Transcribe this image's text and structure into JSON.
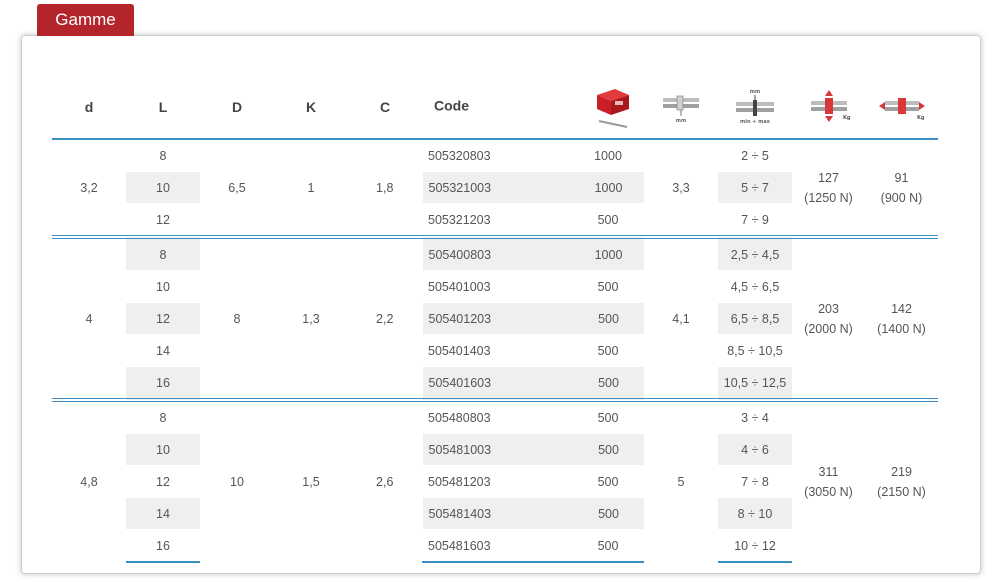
{
  "tab": {
    "label": "Gamme"
  },
  "columns": [
    "d",
    "L",
    "D",
    "K",
    "C",
    "Code"
  ],
  "icons": [
    "box-icon",
    "thickness-icon",
    "grip-range-icon",
    "shear-force-icon",
    "tensile-force-icon"
  ],
  "groups": [
    {
      "d": "3,2",
      "D": "6,5",
      "K": "1",
      "C": "1,8",
      "thickness": "3,3",
      "shear_kg": "127",
      "shear_n": "(1250 N)",
      "tensile_kg": "91",
      "tensile_n": "(900 N)",
      "rows": [
        {
          "L": "8",
          "code": "505320803",
          "box": "1000",
          "grip": "2 ÷ 5"
        },
        {
          "L": "10",
          "code": "505321003",
          "box": "1000",
          "grip": "5 ÷ 7"
        },
        {
          "L": "12",
          "code": "505321203",
          "box": "500",
          "grip": "7 ÷ 9"
        }
      ]
    },
    {
      "d": "4",
      "D": "8",
      "K": "1,3",
      "C": "2,2",
      "thickness": "4,1",
      "shear_kg": "203",
      "shear_n": "(2000 N)",
      "tensile_kg": "142",
      "tensile_n": "(1400 N)",
      "rows": [
        {
          "L": "8",
          "code": "505400803",
          "box": "1000",
          "grip": "2,5 ÷ 4,5"
        },
        {
          "L": "10",
          "code": "505401003",
          "box": "500",
          "grip": "4,5 ÷ 6,5"
        },
        {
          "L": "12",
          "code": "505401203",
          "box": "500",
          "grip": "6,5 ÷ 8,5"
        },
        {
          "L": "14",
          "code": "505401403",
          "box": "500",
          "grip": "8,5 ÷ 10,5"
        },
        {
          "L": "16",
          "code": "505401603",
          "box": "500",
          "grip": "10,5 ÷ 12,5"
        }
      ]
    },
    {
      "d": "4,8",
      "D": "10",
      "K": "1,5",
      "C": "2,6",
      "thickness": "5",
      "shear_kg": "311",
      "shear_n": "(3050 N)",
      "tensile_kg": "219",
      "tensile_n": "(2150 N)",
      "rows": [
        {
          "L": "8",
          "code": "505480803",
          "box": "500",
          "grip": "3 ÷ 4"
        },
        {
          "L": "10",
          "code": "505481003",
          "box": "500",
          "grip": "4 ÷ 6"
        },
        {
          "L": "12",
          "code": "505481203",
          "box": "500",
          "grip": "7 ÷ 8"
        },
        {
          "L": "14",
          "code": "505481403",
          "box": "500",
          "grip": "8 ÷ 10"
        },
        {
          "L": "16",
          "code": "505481603",
          "box": "500",
          "grip": "10 ÷ 12"
        }
      ]
    }
  ],
  "colors": {
    "accent_red": "#b3242b",
    "table_blue": "#3b8fc7",
    "stripe": "#efefef"
  }
}
